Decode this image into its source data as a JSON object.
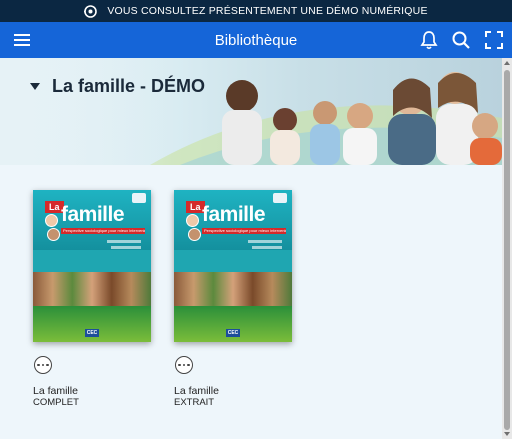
{
  "demo_bar": {
    "icon": "eye-icon",
    "text": "VOUS CONSULTEZ PRÉSENTEMENT UNE DÉMO NUMÉRIQUE"
  },
  "header": {
    "title": "Bibliothèque",
    "icons": [
      "menu-icon",
      "bell-icon",
      "search-icon",
      "fullscreen-icon"
    ]
  },
  "section": {
    "title": "La famille - DÉMO"
  },
  "books": [
    {
      "title": "La famille",
      "subtitle": "COMPLET",
      "cover": {
        "la": "La",
        "famille": "famille",
        "tagline": "Perspective sociologique pour mieux intervenir",
        "publisher": "CEC"
      }
    },
    {
      "title": "La famille",
      "subtitle": "EXTRAIT",
      "cover": {
        "la": "La",
        "famille": "famille",
        "tagline": "Perspective sociologique pour mieux intervenir",
        "publisher": "CEC"
      }
    }
  ],
  "colors": {
    "demo_bar_bg": "#0b2742",
    "header_bg": "#1565d8",
    "cover_teal": "#1fa6b1",
    "cover_red": "#d52a2a"
  }
}
